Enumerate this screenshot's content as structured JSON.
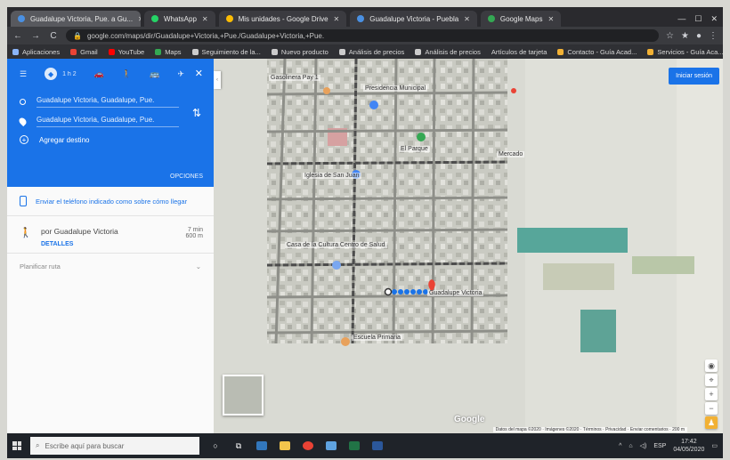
{
  "browser": {
    "tabs": [
      {
        "title": "Guadalupe Victoria, Pue. a Gu..."
      },
      {
        "title": "WhatsApp"
      },
      {
        "title": "Mis unidades - Google Drive"
      },
      {
        "title": "Guadalupe Victoria - Puebla"
      },
      {
        "title": "Google Maps"
      }
    ],
    "address": "google.com/maps/dir/Guadalupe+Victoria,+Pue./Guadalupe+Victoria,+Pue.",
    "bookmarks": [
      "Aplicaciones",
      "Gmail",
      "YouTube",
      "Maps",
      "Seguimiento de la...",
      "Nuevo producto",
      "Análisis de precios",
      "Análisis de precios",
      "Artículos de tarjeta",
      "Contacto - Guía Acad...",
      "Servicios - Guía Aca..."
    ]
  },
  "panel": {
    "mode_time": "1 h 2",
    "origin": "Guadalupe Victoria, Guadalupe, Pue.",
    "destination": "Guadalupe Victoria, Guadalupe, Pue.",
    "add_stop": "Agregar destino",
    "options": "OPCIONES",
    "send_phone": "Enviar el teléfono indicado como sobre cómo llegar",
    "route_via": "por Guadalupe Victoria",
    "route_time": "7 min",
    "route_dist": "600 m",
    "details": "DETALLES",
    "all_routes": "Planificar ruta"
  },
  "map": {
    "share_label": "Iniciar sesión",
    "labels": [
      {
        "text": "Gasolinera Pay 1"
      },
      {
        "text": "Presidencia Municipal"
      },
      {
        "text": "El Parque"
      },
      {
        "text": "Iglesia de San Juan"
      },
      {
        "text": "Casa de la Cultura Centro de Salud"
      },
      {
        "text": "Guadalupe Victoria"
      },
      {
        "text": "Escuela Primaria"
      },
      {
        "text": "Mercado"
      }
    ],
    "attribution": "Datos del mapa ©2020 · Imágenes ©2020 · Términos · Privacidad · Enviar comentarios · 200 m",
    "google": "Google"
  },
  "taskbar": {
    "search_placeholder": "Escribe aquí para buscar",
    "lang": "ESP",
    "time": "17:42",
    "date": "04/05/2020"
  }
}
